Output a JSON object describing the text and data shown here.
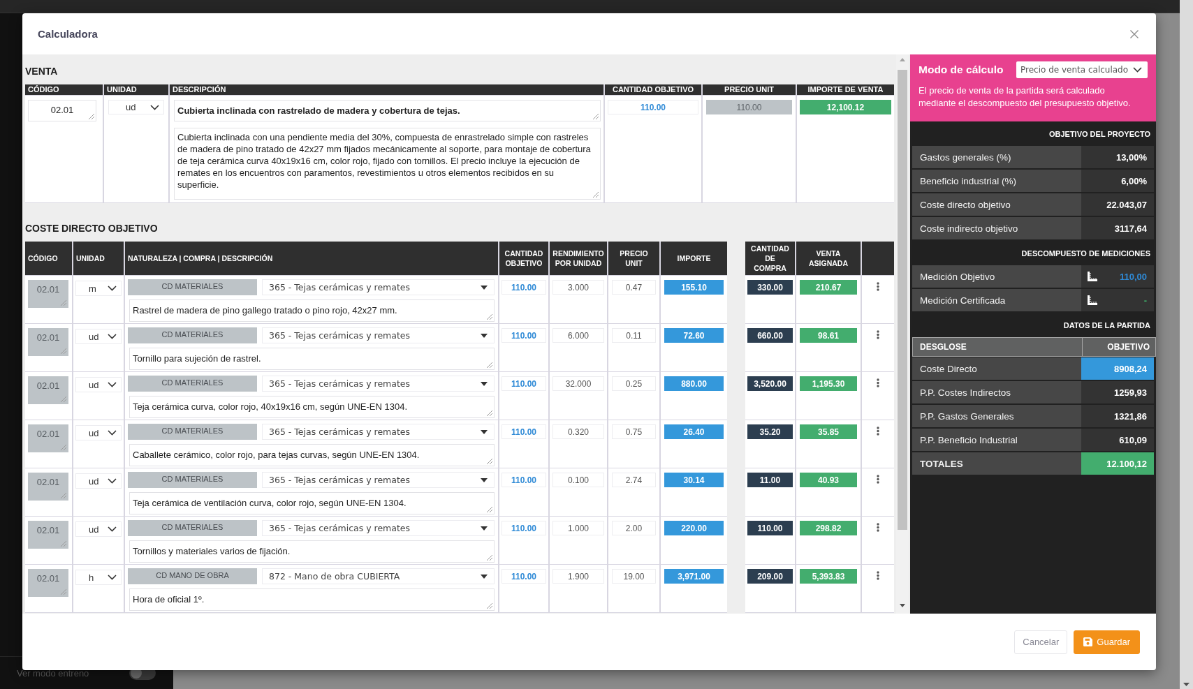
{
  "app": {
    "sidebar_footer": {
      "label": "Ver modo entreno",
      "on": false
    }
  },
  "dialog": {
    "title": "Calculadora",
    "venta": {
      "heading": "VENTA",
      "columns": [
        "CÓDIGO",
        "UNIDAD",
        "DESCRIPCIÓN",
        "CANTIDAD OBJETIVO",
        "PRECIO UNIT",
        "IMPORTE DE VENTA"
      ],
      "code": "02.01",
      "unit": "ud",
      "title": "Cubierta inclinada con rastrelado de madera y cobertura de tejas.",
      "description": "Cubierta inclinada con una pendiente media del 30%, compuesta de enrastrelado simple con rastreles de madera de pino tratado de 42x27 mm fijados mecánicamente al soporte, para montaje de cobertura de teja cerámica curva 40x19x16 cm, color rojo, fijado con tornillos. El precio incluye la ejecución de remates en los encuentros con paramentos, revestimientos u otros elementos recibidos en su superficie.",
      "cantidad_objetivo": "110.00",
      "precio_unit": "110.00",
      "importe_venta": "12,100.12"
    },
    "coste_directo": {
      "heading": "COSTE DIRECTO OBJETIVO",
      "columns": [
        "CÓDIGO",
        "UNIDAD",
        "NATURALEZA | COMPRA | DESCRIPCIÓN",
        "CANTIDAD OBJETIVO",
        "RENDIMIENTO POR UNIDAD",
        "PRECIO UNIT",
        "IMPORTE"
      ],
      "purchase_columns": [
        "CANTIDAD DE COMPRA",
        "VENTA ASIGNADA"
      ],
      "rows": [
        {
          "code": "02.01",
          "unit": "m",
          "nature": "CD MATERIALES",
          "purchase": "365 - Tejas cerámicas y remates",
          "description": "Rastrel de madera de pino gallego tratado o pino rojo, 42x27 mm.",
          "cantidad_objetivo": "110.00",
          "rendimiento": "3.000",
          "precio_unit": "0.47",
          "importe": "155.10",
          "cantidad_compra": "330.00",
          "venta_asignada": "210.67"
        },
        {
          "code": "02.01",
          "unit": "ud",
          "nature": "CD MATERIALES",
          "purchase": "365 - Tejas cerámicas y remates",
          "description": "Tornillo para sujeción de rastrel.",
          "cantidad_objetivo": "110.00",
          "rendimiento": "6.000",
          "precio_unit": "0.11",
          "importe": "72.60",
          "cantidad_compra": "660.00",
          "venta_asignada": "98.61"
        },
        {
          "code": "02.01",
          "unit": "ud",
          "nature": "CD MATERIALES",
          "purchase": "365 - Tejas cerámicas y remates",
          "description": "Teja cerámica curva, color rojo, 40x19x16 cm, según UNE-EN 1304.",
          "cantidad_objetivo": "110.00",
          "rendimiento": "32.000",
          "precio_unit": "0.25",
          "importe": "880.00",
          "cantidad_compra": "3,520.00",
          "venta_asignada": "1,195.30"
        },
        {
          "code": "02.01",
          "unit": "ud",
          "nature": "CD MATERIALES",
          "purchase": "365 - Tejas cerámicas y remates",
          "description": "Caballete cerámico, color rojo, para tejas curvas, según UNE-EN 1304.",
          "cantidad_objetivo": "110.00",
          "rendimiento": "0.320",
          "precio_unit": "0.75",
          "importe": "26.40",
          "cantidad_compra": "35.20",
          "venta_asignada": "35.85"
        },
        {
          "code": "02.01",
          "unit": "ud",
          "nature": "CD MATERIALES",
          "purchase": "365 - Tejas cerámicas y remates",
          "description": "Teja cerámica de ventilación curva, color rojo, según UNE-EN 1304.",
          "cantidad_objetivo": "110.00",
          "rendimiento": "0.100",
          "precio_unit": "2.74",
          "importe": "30.14",
          "cantidad_compra": "11.00",
          "venta_asignada": "40.93"
        },
        {
          "code": "02.01",
          "unit": "ud",
          "nature": "CD MATERIALES",
          "purchase": "365 - Tejas cerámicas y remates",
          "description": "Tornillos y materiales varios de fijación.",
          "cantidad_objetivo": "110.00",
          "rendimiento": "1.000",
          "precio_unit": "2.00",
          "importe": "220.00",
          "cantidad_compra": "110.00",
          "venta_asignada": "298.82"
        },
        {
          "code": "02.01",
          "unit": "h",
          "nature": "CD MANO DE OBRA",
          "purchase": "872 - Mano de obra CUBIERTA",
          "description": "Hora de oficial 1º.",
          "cantidad_objetivo": "110.00",
          "rendimiento": "1.900",
          "precio_unit": "19.00",
          "importe": "3,971.00",
          "cantidad_compra": "209.00",
          "venta_asignada": "5,393.83"
        }
      ]
    },
    "side_panel": {
      "mode_label": "Modo de cálculo",
      "mode_value": "Precio de venta calculado",
      "mode_note": "El precio de venta de la partida será calculado mediante el descompuesto del presupuesto objetivo.",
      "objetivo": {
        "heading": "OBJETIVO DEL PROYECTO",
        "rows": [
          {
            "label": "Gastos generales (%)",
            "value": "13,00%"
          },
          {
            "label": "Beneficio industrial (%)",
            "value": "6,00%"
          },
          {
            "label": "Coste directo objetivo",
            "value": "22.043,07"
          },
          {
            "label": "Coste indirecto objetivo",
            "value": "3117,64"
          }
        ]
      },
      "mediciones": {
        "heading": "DESCOMPUESTO DE MEDICIONES",
        "rows": [
          {
            "label": "Medición Objetivo",
            "value": "110,00",
            "kind": "target"
          },
          {
            "label": "Medición Certificada",
            "value": "-",
            "kind": "certified"
          }
        ]
      },
      "partida": {
        "heading": "DATOS DE LA PARTIDA",
        "columns": [
          "DESGLOSE",
          "OBJETIVO"
        ],
        "rows": [
          {
            "label": "Coste Directo",
            "value": "8908,24",
            "kind": "direct"
          },
          {
            "label": "P.P. Costes Indirectos",
            "value": "1259,93",
            "kind": "plain"
          },
          {
            "label": "P.P. Gastos Generales",
            "value": "1321,86",
            "kind": "plain"
          },
          {
            "label": "P.P. Beneficio Industrial",
            "value": "610,09",
            "kind": "plain"
          },
          {
            "label": "TOTALES",
            "value": "12.100,12",
            "kind": "total"
          }
        ]
      }
    },
    "footer": {
      "buttons": [
        {
          "label": "Cancelar",
          "kind": "secondary"
        },
        {
          "label": "Guardar",
          "kind": "primary"
        }
      ]
    }
  }
}
